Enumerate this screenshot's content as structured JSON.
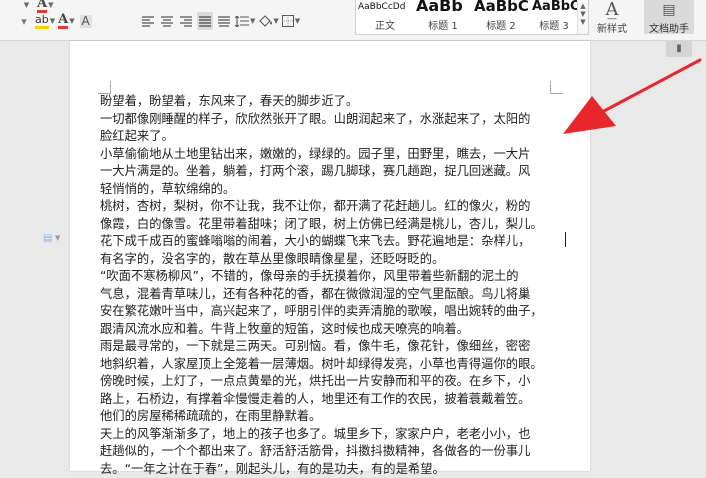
{
  "toolbar": {
    "row1": {
      "font_color_a": "A",
      "highlight": "ab",
      "font_color_a2": "A",
      "char_shading_a": "A"
    }
  },
  "style_gallery": {
    "items": [
      {
        "sample": "AaBbCcDd",
        "label": "正文"
      },
      {
        "sample": "AaBb",
        "label": "标题 1"
      },
      {
        "sample": "AaBbC",
        "label": "标题 2"
      },
      {
        "sample": "AaBbCc",
        "label": "标题 3"
      }
    ],
    "new_style_label": "新样式",
    "doc_helper_label": "文档助手"
  },
  "document": {
    "lines": [
      "盼望着，盼望着，东风来了，春天的脚步近了。",
      "一切都像刚睡醒的样子，欣欣然张开了眼。山朗润起来了，水涨起来了，太阳的",
      "脸红起来了。",
      "小草偷偷地从土地里钻出来，嫩嫩的，绿绿的。园子里，田野里，瞧去，一大片",
      "一大片满是的。坐着，躺着，打两个滚，踢几脚球，赛几趟跑，捉几回迷藏。风",
      "轻悄悄的，草软绵绵的。",
      "桃树，杏树，梨树，你不让我，我不让你，都开满了花赶趟儿。红的像火，粉的",
      "像霞，白的像雪。花里带着甜味；闭了眼，树上仿佛已经满是桃儿，杏儿，梨儿。",
      "花下成千成百的蜜蜂嗡嗡的闹着，大小的蝴蝶飞来飞去。野花遍地是：杂样儿，",
      "有名字的，没名字的，散在草丛里像眼睛像星星，还眨呀眨的。",
      "“吹面不寒杨柳风”，不错的，像母亲的手抚摸着你，风里带着些新翻的泥土的",
      "气息，混着青草味儿，还有各种花的香，都在微微润湿的空气里酝酿。鸟儿将巢",
      "安在繁花嫩叶当中，高兴起来了，呼朋引伴的卖弄清脆的歌喉，唱出婉转的曲子，",
      "跟清风流水应和着。牛背上牧童的短笛，这时候也成天嘹亮的响着。",
      "雨是最寻常的，一下就是三两天。可别恼。看，像牛毛，像花针，像细丝，密密",
      "地斜织着，人家屋顶上全笼着一层薄烟。树叶却绿得发亮，小草也青得逼你的眼。",
      "傍晚时候，上灯了，一点点黄晕的光，烘托出一片安静而和平的夜。在乡下，小",
      "路上，石桥边，有撑着伞慢慢走着的人，地里还有工作的农民，披着蓑戴着笠。",
      "他们的房屋稀稀疏疏的，在雨里静默着。",
      "天上的风筝渐渐多了，地上的孩子也多了。城里乡下，家家户户，老老小小，也",
      "赶趟似的，一个个都出来了。舒活舒活筋骨，抖擞抖擞精神，各做各的一份事儿",
      "去。“一年之计在于春”，刚起头儿，有的是功夫，有的是希望。"
    ]
  },
  "colors": {
    "arrow": "#e8262b",
    "font_color_underline": "#e53935",
    "highlight_underline": "#f5d000",
    "page": "#ffffff",
    "workspace": "#e9e9e9"
  },
  "icons": {
    "font_color": "font-color-icon",
    "highlight": "highlight-icon",
    "char_shading": "char-shading-icon",
    "bullets": "bullet-list-icon",
    "numbering": "numbered-list-icon",
    "align_left": "align-left-icon",
    "align_center": "align-center-icon",
    "align_right": "align-right-icon",
    "justify": "justify-icon",
    "distribute": "distribute-icon",
    "line_spacing": "line-spacing-icon",
    "shading": "paint-bucket-icon",
    "borders": "borders-icon",
    "new_style": "new-style-icon",
    "doc_helper": "doc-helper-icon",
    "paragraph_marker": "paragraph-marker-icon"
  }
}
